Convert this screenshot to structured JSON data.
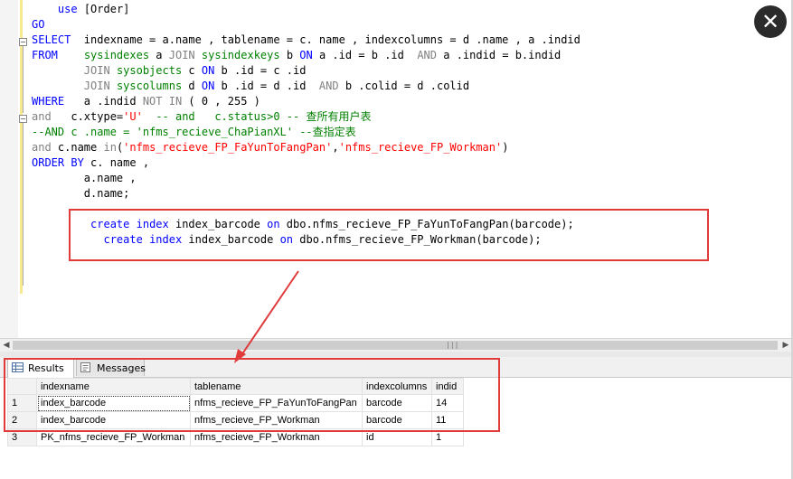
{
  "editor": {
    "lines": [
      {
        "key": "l0",
        "tokens": [
          {
            "t": "    ",
            "c": ""
          },
          {
            "t": "use",
            "c": "kw"
          },
          {
            "t": " [Order]",
            "c": ""
          }
        ]
      },
      {
        "key": "l1",
        "tokens": [
          {
            "t": "GO",
            "c": "kw"
          }
        ]
      },
      {
        "key": "l2",
        "tokens": [
          {
            "t": "SELECT",
            "c": "kw"
          },
          {
            "t": "  indexname = a.name , tablename = c. name , indexcolumns = d .name , a .indid",
            "c": ""
          }
        ]
      },
      {
        "key": "l3",
        "tokens": [
          {
            "t": "FROM",
            "c": "kw"
          },
          {
            "t": "    ",
            "c": ""
          },
          {
            "t": "sysindexes",
            "c": "cm"
          },
          {
            "t": " a ",
            "c": ""
          },
          {
            "t": "JOIN",
            "c": "gray"
          },
          {
            "t": " ",
            "c": ""
          },
          {
            "t": "sysindexkeys",
            "c": "cm"
          },
          {
            "t": " b ",
            "c": ""
          },
          {
            "t": "ON",
            "c": "kw"
          },
          {
            "t": " a .id = b .id  ",
            "c": ""
          },
          {
            "t": "AND",
            "c": "gray"
          },
          {
            "t": " a .indid = b.indid",
            "c": ""
          }
        ]
      },
      {
        "key": "l4",
        "tokens": [
          {
            "t": "        ",
            "c": ""
          },
          {
            "t": "JOIN",
            "c": "gray"
          },
          {
            "t": " ",
            "c": ""
          },
          {
            "t": "sysobjects",
            "c": "cm"
          },
          {
            "t": " c ",
            "c": ""
          },
          {
            "t": "ON",
            "c": "kw"
          },
          {
            "t": " b .id = c .id",
            "c": ""
          }
        ]
      },
      {
        "key": "l5",
        "tokens": [
          {
            "t": "        ",
            "c": ""
          },
          {
            "t": "JOIN",
            "c": "gray"
          },
          {
            "t": " ",
            "c": ""
          },
          {
            "t": "syscolumns",
            "c": "cm"
          },
          {
            "t": " d ",
            "c": ""
          },
          {
            "t": "ON",
            "c": "kw"
          },
          {
            "t": " b .id = d .id  ",
            "c": ""
          },
          {
            "t": "AND",
            "c": "gray"
          },
          {
            "t": " b .colid = d .colid",
            "c": ""
          }
        ]
      },
      {
        "key": "l6",
        "tokens": [
          {
            "t": "WHERE",
            "c": "kw"
          },
          {
            "t": "   a .indid ",
            "c": ""
          },
          {
            "t": "NOT IN",
            "c": "gray"
          },
          {
            "t": " ( 0 , 255 )",
            "c": ""
          }
        ]
      },
      {
        "key": "l7",
        "tokens": [
          {
            "t": "and",
            "c": "gray"
          },
          {
            "t": "   c.xtype=",
            "c": ""
          },
          {
            "t": "'U'",
            "c": "str"
          },
          {
            "t": "  ",
            "c": ""
          },
          {
            "t": "-- and   c.status>0 -- 查所有用户表",
            "c": "cm"
          }
        ]
      },
      {
        "key": "l8",
        "tokens": [
          {
            "t": "--AND c .name = 'nfms_recieve_ChaPianXL' --查指定表",
            "c": "cm"
          }
        ]
      },
      {
        "key": "l9",
        "tokens": [
          {
            "t": "and",
            "c": "gray"
          },
          {
            "t": " c.name ",
            "c": ""
          },
          {
            "t": "in",
            "c": "gray"
          },
          {
            "t": "(",
            "c": ""
          },
          {
            "t": "'nfms_recieve_FP_FaYunToFangPan'",
            "c": "str"
          },
          {
            "t": ",",
            "c": ""
          },
          {
            "t": "'nfms_recieve_FP_Workman'",
            "c": "str"
          },
          {
            "t": ")",
            "c": ""
          }
        ]
      },
      {
        "key": "l10",
        "tokens": [
          {
            "t": "ORDER BY",
            "c": "kw"
          },
          {
            "t": " c. name ,",
            "c": ""
          }
        ]
      },
      {
        "key": "l11",
        "tokens": [
          {
            "t": "        a.name ,",
            "c": ""
          }
        ]
      },
      {
        "key": "l12",
        "tokens": [
          {
            "t": "        d.name;",
            "c": ""
          }
        ]
      },
      {
        "key": "l13",
        "tokens": [
          {
            "t": "         ",
            "c": ""
          },
          {
            "t": "create",
            "c": "kw"
          },
          {
            "t": " ",
            "c": ""
          },
          {
            "t": "index",
            "c": "kw"
          },
          {
            "t": " index_barcode ",
            "c": ""
          },
          {
            "t": "on",
            "c": "kw"
          },
          {
            "t": " dbo.nfms_recieve_FP_FaYunToFangPan(barcode);",
            "c": ""
          }
        ]
      },
      {
        "key": "l14",
        "tokens": [
          {
            "t": "           ",
            "c": ""
          },
          {
            "t": "create",
            "c": "kw"
          },
          {
            "t": " ",
            "c": ""
          },
          {
            "t": "index",
            "c": "kw"
          },
          {
            "t": " index_barcode ",
            "c": ""
          },
          {
            "t": "on",
            "c": "kw"
          },
          {
            "t": " dbo.nfms_recieve_FP_Workman(barcode);",
            "c": ""
          }
        ]
      }
    ],
    "fold_markers": [
      "−",
      "−"
    ]
  },
  "close_button": {
    "label": "✕"
  },
  "scrollbar": {
    "left_arrow": "◀",
    "right_arrow": "▶",
    "grip": "|||"
  },
  "tabs": [
    {
      "label": "Results",
      "icon": "grid-icon",
      "active": true
    },
    {
      "label": "Messages",
      "icon": "messages-icon",
      "active": false
    }
  ],
  "results": {
    "columns": [
      "indexname",
      "tablename",
      "indexcolumns",
      "indid"
    ],
    "rows": [
      {
        "num": "1",
        "indexname": "index_barcode",
        "tablename": "nfms_recieve_FP_FaYunToFangPan",
        "indexcolumns": "barcode",
        "indid": "14"
      },
      {
        "num": "2",
        "indexname": "index_barcode",
        "tablename": "nfms_recieve_FP_Workman",
        "indexcolumns": "barcode",
        "indid": "11"
      },
      {
        "num": "3",
        "indexname": "PK_nfms_recieve_FP_Workman",
        "tablename": "nfms_recieve_FP_Workman",
        "indexcolumns": "id",
        "indid": "1"
      }
    ]
  },
  "annotation_color": "#e03a3a"
}
